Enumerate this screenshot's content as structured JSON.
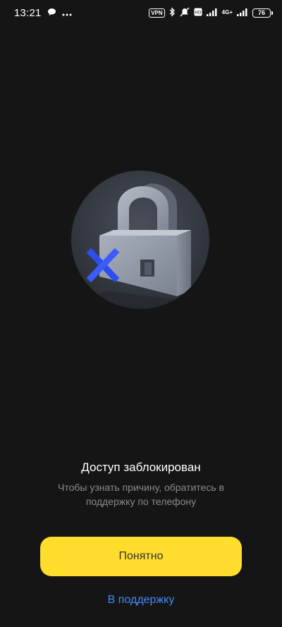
{
  "status_bar": {
    "time": "13:21",
    "vpn": "VPN",
    "network": "4G+",
    "battery": "76",
    "icons": [
      "chat-bubble-icon",
      "more-dots-icon",
      "bluetooth-icon",
      "muted-bell-icon",
      "signal-icon",
      "signal-icon-2"
    ]
  },
  "illustration": {
    "icon": "padlock-blocked-icon",
    "accent_color": "#2b4ef0"
  },
  "content": {
    "title": "Доступ заблокирован",
    "subtitle": "Чтобы узнать причину, обратитесь в поддержку по телефону"
  },
  "actions": {
    "primary_label": "Понятно",
    "support_label": "В поддержку"
  },
  "colors": {
    "background": "#151515",
    "button": "#ffdd2d",
    "link": "#428bf9"
  }
}
